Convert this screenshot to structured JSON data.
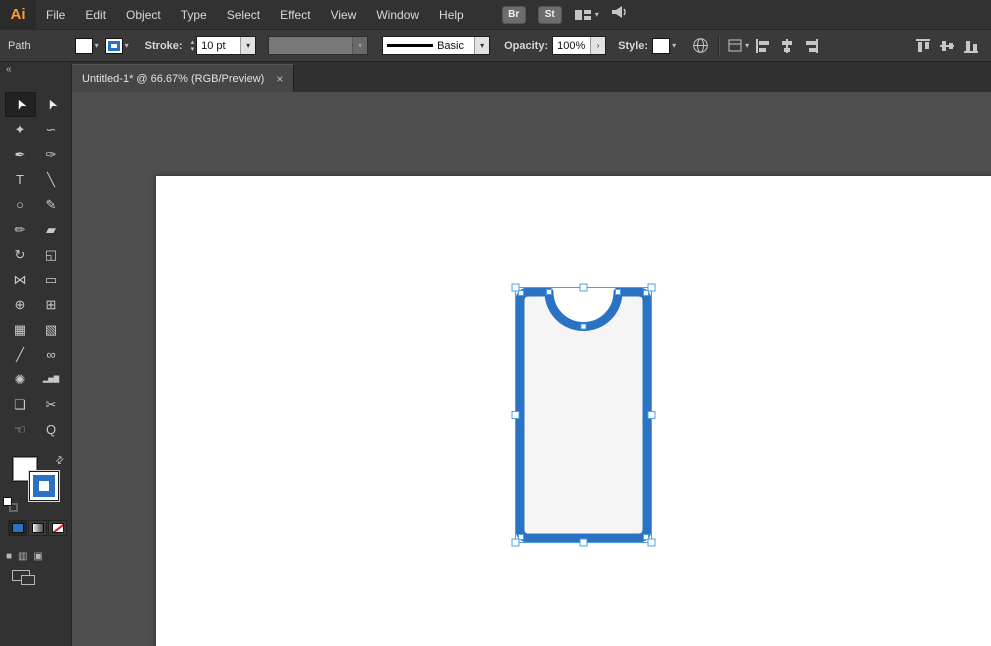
{
  "menubar": {
    "logo": "Ai",
    "items": [
      "File",
      "Edit",
      "Object",
      "Type",
      "Select",
      "Effect",
      "View",
      "Window",
      "Help"
    ],
    "bridge_button": "Br",
    "stock_button": "St"
  },
  "control_bar": {
    "context": "Path",
    "stroke_label": "Stroke:",
    "stroke_weight": "10 pt",
    "stroke_style": "Basic",
    "opacity_label": "Opacity:",
    "opacity_value": "100%",
    "style_label": "Style:"
  },
  "tab": {
    "title": "Untitled-1* @ 66.67% (RGB/Preview)"
  },
  "toolbar": {
    "tools": [
      {
        "name": "selection-tool",
        "glyph": "➤",
        "rot": true,
        "active": true
      },
      {
        "name": "direct-selection-tool",
        "glyph": "➤",
        "rot": true,
        "muted": true
      },
      {
        "name": "magic-wand-tool",
        "glyph": "✦"
      },
      {
        "name": "lasso-tool",
        "glyph": "∽"
      },
      {
        "name": "pen-tool",
        "glyph": "✒"
      },
      {
        "name": "curvature-tool",
        "glyph": "✑"
      },
      {
        "name": "type-tool",
        "glyph": "T"
      },
      {
        "name": "line-segment-tool",
        "glyph": "╲"
      },
      {
        "name": "ellipse-tool",
        "glyph": "○"
      },
      {
        "name": "paintbrush-tool",
        "glyph": "✎"
      },
      {
        "name": "shaper-tool",
        "glyph": "✏"
      },
      {
        "name": "eraser-tool",
        "glyph": "▰"
      },
      {
        "name": "rotate-tool",
        "glyph": "↻"
      },
      {
        "name": "scale-tool",
        "glyph": "◱"
      },
      {
        "name": "width-tool",
        "glyph": "⋈"
      },
      {
        "name": "free-transform-tool",
        "glyph": "▭"
      },
      {
        "name": "shape-builder-tool",
        "glyph": "⊕"
      },
      {
        "name": "perspective-grid-tool",
        "glyph": "⊞"
      },
      {
        "name": "mesh-tool",
        "glyph": "▦"
      },
      {
        "name": "gradient-tool",
        "glyph": "▧"
      },
      {
        "name": "eyedropper-tool",
        "glyph": "╱"
      },
      {
        "name": "blend-tool",
        "glyph": "∞"
      },
      {
        "name": "symbol-sprayer-tool",
        "glyph": "✺"
      },
      {
        "name": "column-graph-tool",
        "glyph": "▂▅▇",
        "small": true
      },
      {
        "name": "artboard-tool",
        "glyph": "❏"
      },
      {
        "name": "slice-tool",
        "glyph": "✂"
      },
      {
        "name": "hand-tool",
        "glyph": "☜"
      },
      {
        "name": "zoom-tool",
        "glyph": "Q"
      }
    ]
  },
  "shape": {
    "kind": "rounded-rectangle-with-top-notch",
    "selected": true,
    "fill_color": "#f5f5f5",
    "stroke_color": "#2b72c4",
    "stroke_weight": "10 pt"
  },
  "colors": {
    "selection": "#4da1e0",
    "accent_stroke": "#2b72c4",
    "pasteboard": "#4f4f4f",
    "panel": "#323232",
    "artboard": "#ffffff"
  },
  "icons": {
    "chevron_down": "▾",
    "chevron_up": "▴",
    "flyout_right": "›",
    "collapse_panel": "«",
    "swap_fill_stroke": "⇄",
    "close_tab": "×",
    "draw_normal": "■",
    "draw_behind": "▥",
    "draw_inside": "▣"
  }
}
